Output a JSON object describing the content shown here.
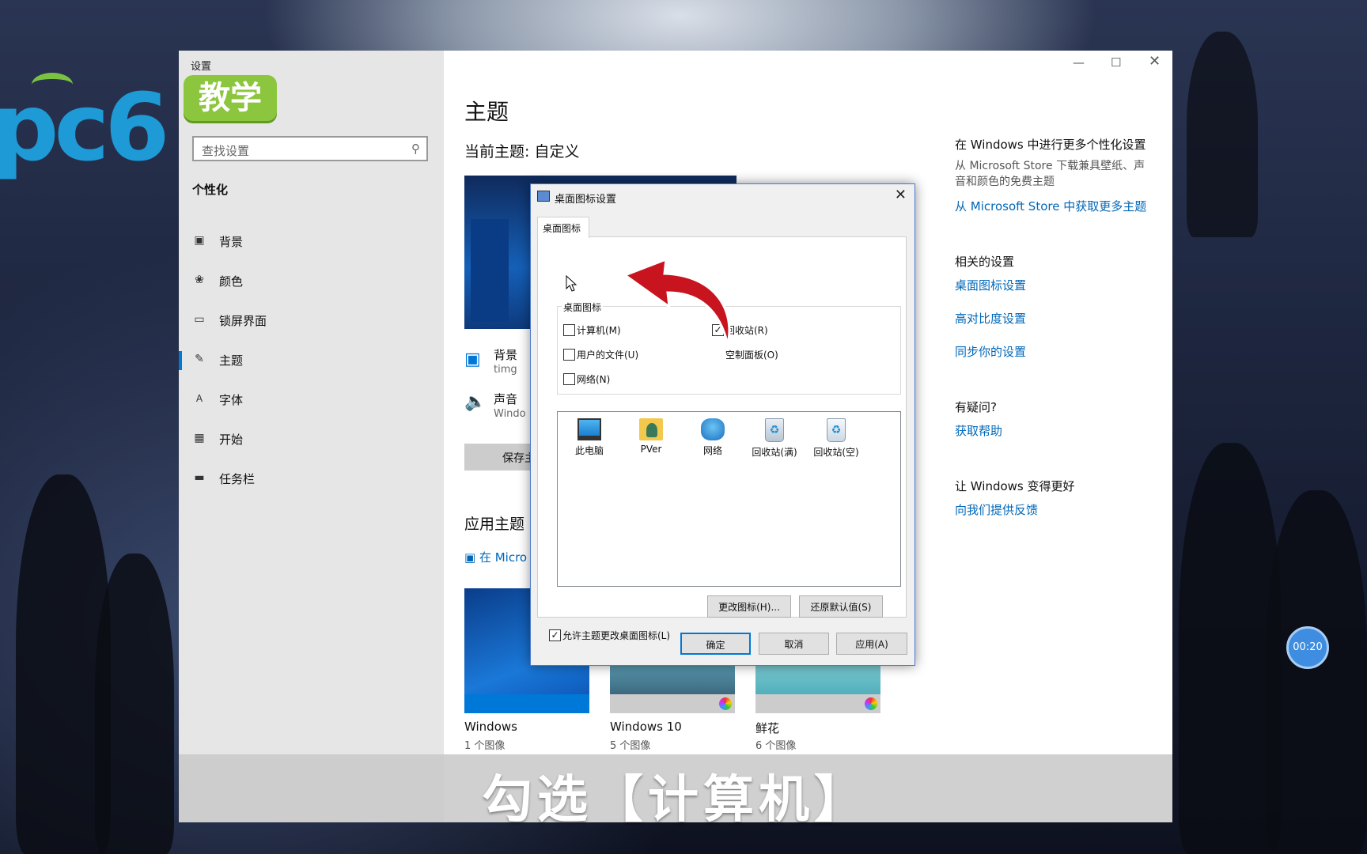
{
  "branding": {
    "logo_text": "pc6",
    "badge_text": "教学"
  },
  "settings_window": {
    "title": "设置",
    "search_placeholder": "查找设置",
    "section_title": "个性化",
    "nav_items": [
      {
        "label": "背景",
        "icon": "picture-icon"
      },
      {
        "label": "颜色",
        "icon": "palette-icon"
      },
      {
        "label": "锁屏界面",
        "icon": "lockscreen-icon"
      },
      {
        "label": "主题",
        "icon": "theme-brush-icon",
        "active": true
      },
      {
        "label": "字体",
        "icon": "font-icon"
      },
      {
        "label": "开始",
        "icon": "start-icon"
      },
      {
        "label": "任务栏",
        "icon": "taskbar-icon"
      }
    ],
    "main": {
      "page_title": "主题",
      "current_theme": "当前主题: 自定义",
      "background_label": "背景",
      "background_value": "timg",
      "sound_label": "声音",
      "sound_value": "Windo",
      "save_button": "保存主",
      "apply_theme_heading": "应用主题",
      "store_link": "在 Micro",
      "themes": [
        {
          "name": "Windows",
          "count": "1 个图像"
        },
        {
          "name": "Windows 10",
          "count": "5 个图像"
        },
        {
          "name": "鲜花",
          "count": "6 个图像"
        }
      ]
    },
    "right_panel": {
      "more_heading": "在 Windows 中进行更多个性化设置",
      "more_desc": "从 Microsoft Store 下载兼具壁纸、声音和颜色的免费主题",
      "more_link": "从 Microsoft Store 中获取更多主题",
      "related_heading": "相关的设置",
      "related_links": [
        "桌面图标设置",
        "高对比度设置",
        "同步你的设置"
      ],
      "question_heading": "有疑问?",
      "help_link": "获取帮助",
      "better_heading": "让 Windows 变得更好",
      "feedback_link": "向我们提供反馈"
    }
  },
  "dialog": {
    "title": "桌面图标设置",
    "tab_label": "桌面图标",
    "group_title": "桌面图标",
    "checkboxes": [
      {
        "label": "计算机(M)",
        "checked": false
      },
      {
        "label": "回收站(R)",
        "checked": true
      },
      {
        "label": "用户的文件(U)",
        "checked": false
      },
      {
        "label": "控制面板(O)",
        "checked": false
      },
      {
        "label": "网络(N)",
        "checked": false
      }
    ],
    "control_panel_visible": "空制面板(O)",
    "icons": [
      {
        "label": "此电脑",
        "icon": "computer-icon"
      },
      {
        "label": "PVer",
        "icon": "user-folder-icon"
      },
      {
        "label": "网络",
        "icon": "network-icon"
      },
      {
        "label": "回收站(满)",
        "icon": "recycle-bin-full-icon"
      },
      {
        "label": "回收站(空)",
        "icon": "recycle-bin-empty-icon"
      }
    ],
    "change_icon_button": "更改图标(H)...",
    "restore_default_button": "还原默认值(S)",
    "allow_themes_label": "允许主题更改桌面图标(L)",
    "allow_themes_checked": true,
    "ok_button": "确定",
    "cancel_button": "取消",
    "apply_button": "应用(A)"
  },
  "caption": "勾选【计算机】",
  "timer": "00:20",
  "colors": {
    "accent": "#0078d7",
    "link": "#0067b8",
    "arrow": "#c8141e",
    "badge": "#8cc63f",
    "logo": "#1e9ad6"
  }
}
